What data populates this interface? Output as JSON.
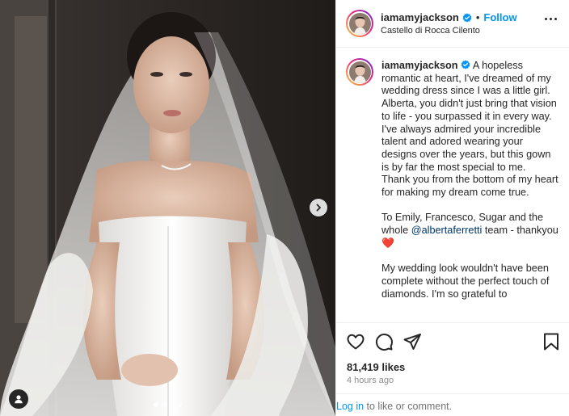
{
  "post": {
    "username": "iamamyjackson",
    "verified": true,
    "follow_label": "Follow",
    "separator": "•",
    "location": "Castello di Rocca Cilento",
    "caption_lines": [
      "A hopeless romantic at heart, I've dreamed of my wedding dress since I was a little girl. Alberta, you didn't just bring that vision to life - you surpassed it in every way. I've always admired your incredible talent and adored wearing your designs over the years, but this gown is by far the most special to me.",
      "Thank you from the bottom of my heart for making my dream come true."
    ],
    "mention_before": "To Emily, Francesco, Sugar and the whole ",
    "mention": "@albertaferretti",
    "mention_after": " team - thankyou ",
    "heart_emoji": "❤️",
    "caption_tail": "My wedding look wouldn't have been complete without the perfect touch of diamonds. I'm so grateful to",
    "likes": "81,419 likes",
    "time": "4 hours ago",
    "login_link": "Log in",
    "login_rest": " to like or comment.",
    "carousel": {
      "count": 4,
      "active": 1
    }
  },
  "icons": {
    "verified": "verified-badge-icon",
    "more": "more-options-icon",
    "like": "heart-outline-icon",
    "comment": "comment-icon",
    "share": "paper-plane-icon",
    "save": "bookmark-icon",
    "next": "chevron-right-icon",
    "tagged": "user-tag-icon"
  },
  "colors": {
    "brand_blue": "#0095f6",
    "mention": "#00376b",
    "heart_red": "#ed4956",
    "muted": "#8e8e8e",
    "text": "#262626"
  }
}
